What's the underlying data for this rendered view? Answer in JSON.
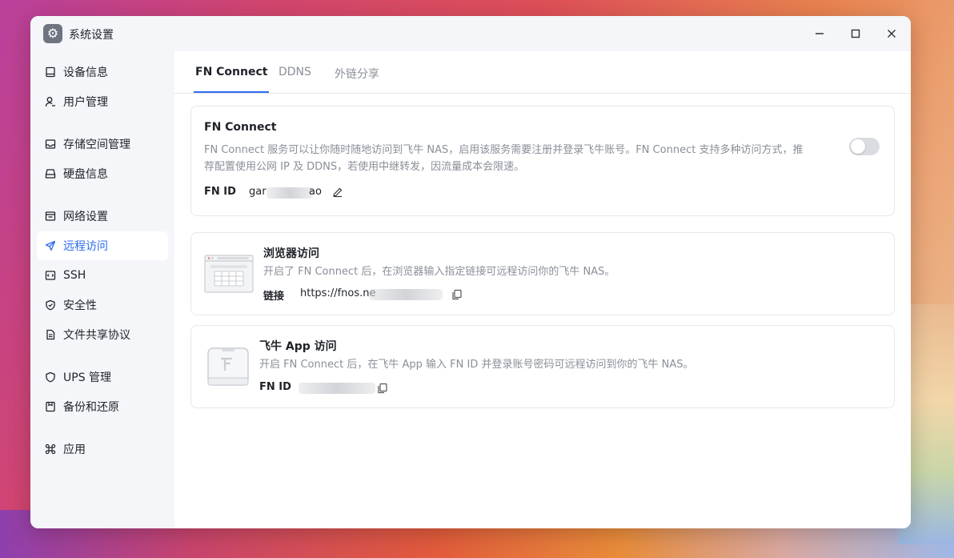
{
  "window": {
    "title": "系统设置"
  },
  "sidebar": {
    "items": [
      {
        "label": "设备信息",
        "icon": "device-icon"
      },
      {
        "label": "用户管理",
        "icon": "user-icon"
      },
      {
        "label": "存储空间管理",
        "icon": "storage-icon"
      },
      {
        "label": "硬盘信息",
        "icon": "disk-icon"
      },
      {
        "label": "网络设置",
        "icon": "network-icon"
      },
      {
        "label": "远程访问",
        "icon": "send-icon"
      },
      {
        "label": "SSH",
        "icon": "code-icon"
      },
      {
        "label": "安全性",
        "icon": "shield-icon"
      },
      {
        "label": "文件共享协议",
        "icon": "file-icon"
      },
      {
        "label": "UPS 管理",
        "icon": "ups-shield-icon"
      },
      {
        "label": "备份和还原",
        "icon": "backup-icon"
      },
      {
        "label": "应用",
        "icon": "command-icon"
      }
    ],
    "active": "远程访问"
  },
  "tabs": [
    {
      "label": "FN Connect"
    },
    {
      "label": "DDNS"
    },
    {
      "label": "外链分享"
    }
  ],
  "fn_connect": {
    "title": "FN Connect",
    "description_line1": "FN Connect 服务可以让你随时随地访问到飞牛 NAS，启用该服务需要注册并登录飞牛账号。FN Connect 支持多种访问方式，推",
    "description_line2": "荐配置使用公网 IP 及 DDNS，若使用中继转发，因流量成本会限速。",
    "id_label": "FN ID",
    "id_value_prefix": "gar",
    "id_value_suffix": "ao",
    "enabled": false
  },
  "browser_access": {
    "title": "浏览器访问",
    "description": "开启了 FN Connect 后，在浏览器输入指定链接可远程访问你的飞牛 NAS。",
    "link_label": "链接",
    "link_value_visible": "https://fnos.ne"
  },
  "app_access": {
    "title": "飞牛 App 访问",
    "description": "开启 FN Connect 后，在飞牛 App 输入 FN ID 并登录账号密码可远程访问到你的飞牛 NAS。",
    "id_label": "FN ID"
  }
}
